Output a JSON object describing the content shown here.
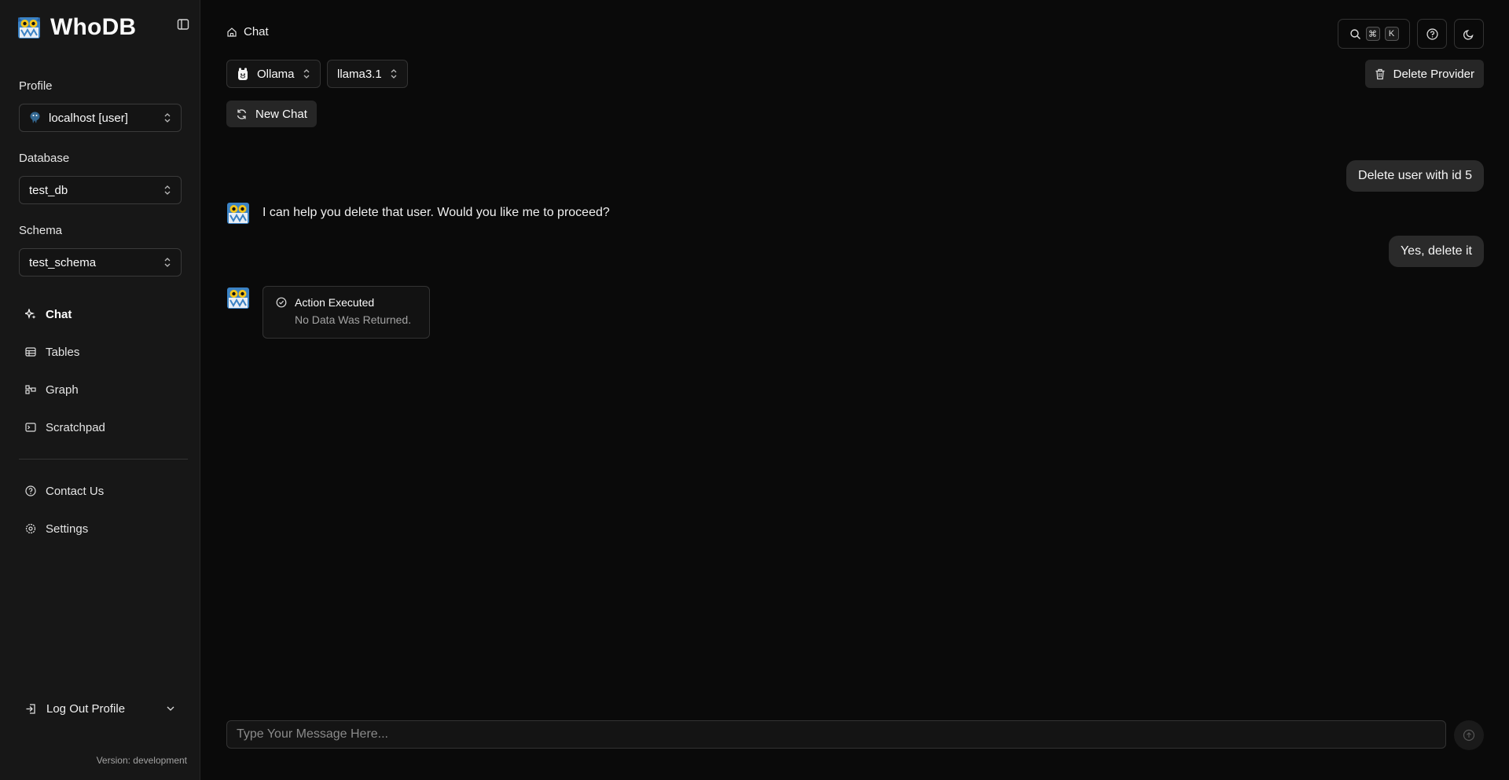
{
  "app": {
    "name": "WhoDB",
    "version": "Version: development"
  },
  "sidebar": {
    "profile": {
      "label": "Profile",
      "value": "localhost [user]"
    },
    "database": {
      "label": "Database",
      "value": "test_db"
    },
    "schema": {
      "label": "Schema",
      "value": "test_schema"
    },
    "nav": [
      {
        "label": "Chat",
        "icon": "sparkles-icon",
        "active": true
      },
      {
        "label": "Tables",
        "icon": "table-icon"
      },
      {
        "label": "Graph",
        "icon": "graph-icon"
      },
      {
        "label": "Scratchpad",
        "icon": "terminal-icon"
      }
    ],
    "secondary": [
      {
        "label": "Contact Us",
        "icon": "help-circle-icon"
      },
      {
        "label": "Settings",
        "icon": "settings-icon"
      }
    ],
    "logout_label": "Log Out Profile"
  },
  "header": {
    "breadcrumb": "Chat",
    "shortcut_keys": [
      "⌘",
      "K"
    ]
  },
  "toolbar": {
    "provider": "Ollama",
    "model": "llama3.1",
    "delete_provider_label": "Delete Provider",
    "new_chat_label": "New Chat"
  },
  "messages": {
    "user_1": "Delete user with id 5",
    "bot_1": "I can help you delete that user. Would you like me to proceed?",
    "user_2": "Yes, delete it",
    "action": {
      "title": "Action Executed",
      "subtitle": "No Data Was Returned."
    }
  },
  "composer": {
    "placeholder": "Type Your Message Here..."
  },
  "colors": {
    "background": "#0a0a0a",
    "sidebar": "#171717",
    "bubble": "#2a2a2a",
    "owl_blue": "#3b82c4",
    "owl_yellow": "#f5c518"
  }
}
